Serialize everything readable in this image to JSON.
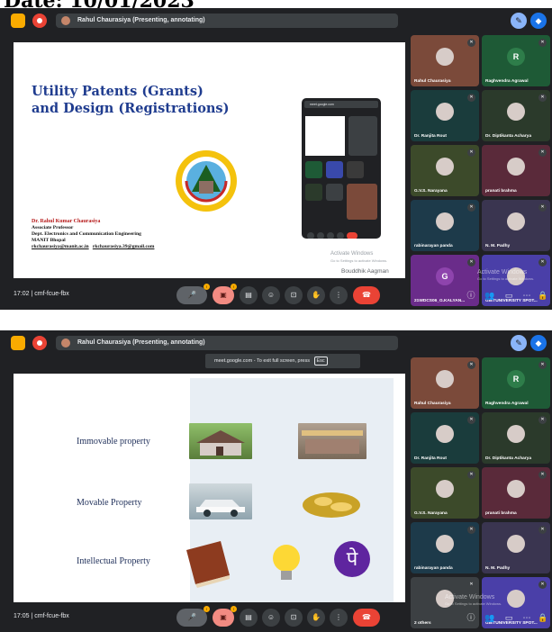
{
  "header": {
    "date_text": "Date: 10/01/2023"
  },
  "meeting_1": {
    "presenter_chip": "Rahul Chaurasiya (Presenting, annotating)",
    "time_label": "17:02",
    "meeting_code": "cmf-fcue-fbx",
    "slide": {
      "title_line1": "Utility Patents (Grants)",
      "title_line2": "and Design (Registrations)",
      "author_name": "Dr. Rahul Kumar Chaurasiya",
      "author_role": "Associate Professor",
      "author_dept": "Dept. Electronics and Communication Engineering",
      "author_inst": "MANIT Bhopal",
      "email_1": "rkchaurasiya@manit.ac.in",
      "email_2": "rkchaurasiya.39@gmail.com",
      "phone_url": "meet.google.com",
      "watermark_title": "Activate Windows",
      "watermark_sub": "Go to Settings to activate Windows.",
      "footer_brand": "Bouddhik Aagman"
    },
    "tiles": [
      {
        "name": "Rahul Chaurasiya",
        "bg": "#7b4a3a"
      },
      {
        "name": "Raghvendra Agrawal",
        "letter": "R",
        "bg": "#1e5a36",
        "av": "#2e7d4a"
      },
      {
        "name": "Dr. Ranjita Rout",
        "bg": "#1a3c3c"
      },
      {
        "name": "Dr. Diptikanta Acharya",
        "bg": "#2b3a2b"
      },
      {
        "name": "G.V.S. Narayana",
        "bg": "#3c4a2a"
      },
      {
        "name": "pranati brahma",
        "bg": "#5a2a3a"
      },
      {
        "name": "rabinarayan panda",
        "bg": "#1d3a4a"
      },
      {
        "name": "N. M. Padhy",
        "bg": "#3a3550"
      },
      {
        "name": "21WDCS06_G.KALYAN...",
        "letter": "G",
        "bg": "#6a2c8a",
        "av": "#8e44ad"
      },
      {
        "name": "GIETUNIVERSITY SPOT...",
        "bg": "#4a3fa8"
      }
    ],
    "activate_title": "Activate Windows",
    "activate_sub": "Go to Settings to activate Windows."
  },
  "meeting_2": {
    "presenter_chip": "Rahul Chaurasiya (Presenting, annotating)",
    "time_label": "17:05",
    "meeting_code": "cmf-fcue-fbx",
    "tooltip_text": "meet.google.com - To exit full screen, press",
    "tooltip_key": "Esc",
    "slide": {
      "row1": "Immovable property",
      "row2": "Movable Property",
      "row3": "Intellectual Property"
    },
    "tiles": [
      {
        "name": "Rahul Chaurasiya",
        "bg": "#7b4a3a"
      },
      {
        "name": "Raghvendra Agrawal",
        "letter": "R",
        "bg": "#1e5a36",
        "av": "#2e7d4a"
      },
      {
        "name": "Dr. Ranjita Rout",
        "bg": "#1a3c3c"
      },
      {
        "name": "Dr. Diptikanta Acharya",
        "bg": "#2b3a2b"
      },
      {
        "name": "G.V.S. Narayana",
        "bg": "#3c4a2a"
      },
      {
        "name": "pranati brahma",
        "bg": "#5a2a3a"
      },
      {
        "name": "rabinarayan panda",
        "bg": "#1d3a4a"
      },
      {
        "name": "N. M. Padhy",
        "bg": "#3a3550"
      },
      {
        "name": "2 others",
        "bg": "#3c4043"
      },
      {
        "name": "GIETUNIVERSITY SPOT...",
        "bg": "#4a3fa8"
      }
    ],
    "activate_title": "Activate Windows",
    "activate_sub": "Go to Settings to activate Windows."
  },
  "colors": {
    "meet_bg": "#202124",
    "end_call": "#ea4335",
    "accent": "#1a73e8",
    "slide_title": "#1f3c8f"
  }
}
